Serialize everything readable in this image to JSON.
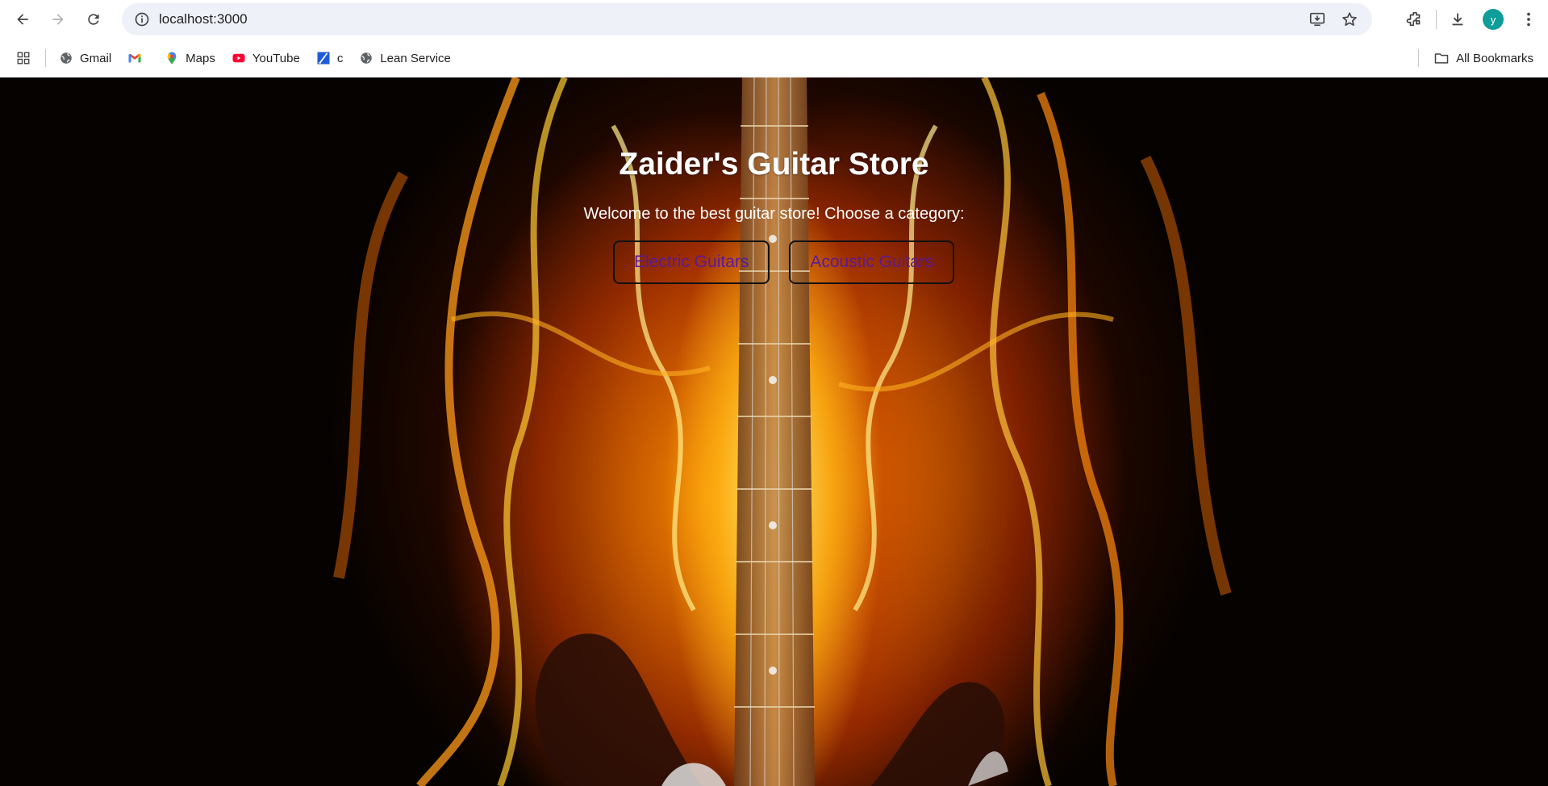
{
  "browser": {
    "url": "localhost:3000",
    "profile_initial": "y",
    "bookmarks": [
      {
        "label": "Gmail",
        "icon": "globe-icon"
      },
      {
        "label": "",
        "icon": "gmail-icon"
      },
      {
        "label": "Maps",
        "icon": "maps-pin-icon"
      },
      {
        "label": "YouTube",
        "icon": "youtube-icon"
      },
      {
        "label": "c",
        "icon": "bookmark-c-icon"
      },
      {
        "label": "Lean Service",
        "icon": "globe-icon"
      }
    ],
    "all_bookmarks_label": "All Bookmarks"
  },
  "page": {
    "title": "Zaider's Guitar Store",
    "subtitle": "Welcome to the best guitar store! Choose a category:",
    "buttons": [
      {
        "label": "Electric Guitars"
      },
      {
        "label": "Acoustic Guitars"
      }
    ],
    "colors": {
      "button_text": "#5a1a9a",
      "button_border": "#111111",
      "title": "#ffffff"
    }
  }
}
